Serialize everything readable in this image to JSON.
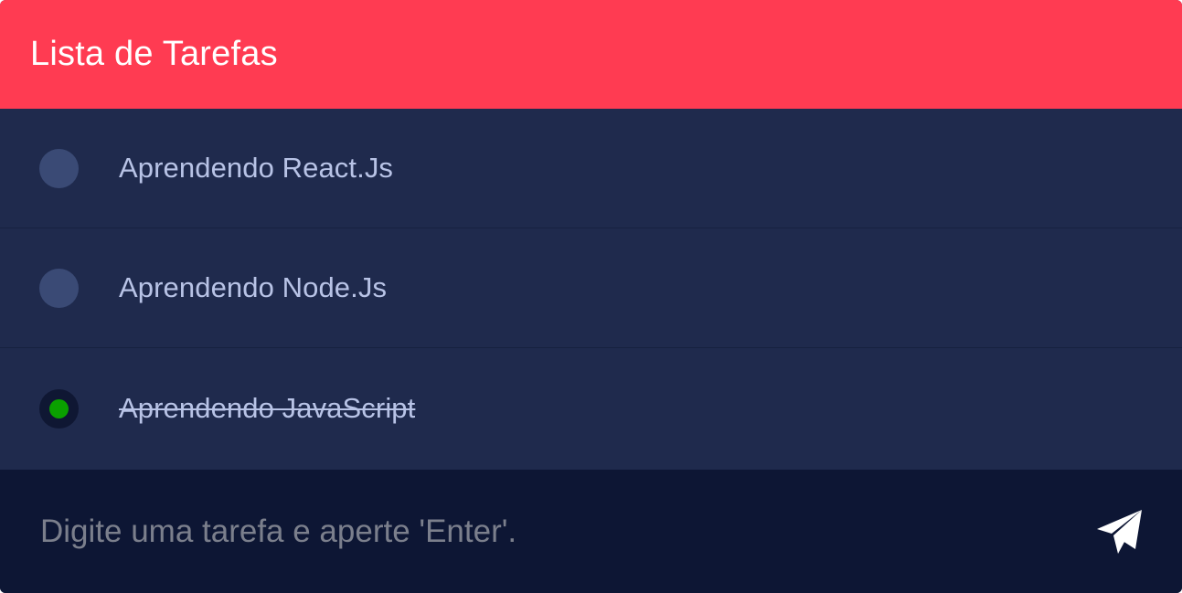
{
  "header": {
    "title": "Lista de Tarefas"
  },
  "tasks": [
    {
      "label": "Aprendendo React.Js",
      "done": false
    },
    {
      "label": "Aprendendo Node.Js",
      "done": false
    },
    {
      "label": "Aprendendo JavaScript",
      "done": true
    }
  ],
  "input": {
    "value": "",
    "placeholder": "Digite uma tarefa e aperte 'Enter'."
  },
  "icons": {
    "send": "paper-plane-icon",
    "check": "check-dot-icon"
  },
  "colors": {
    "header_bg": "#ff3b52",
    "list_bg": "#1f2a4d",
    "input_bg": "#0d1634",
    "check_done": "#0aa000",
    "check_todo": "#3a4a75"
  }
}
